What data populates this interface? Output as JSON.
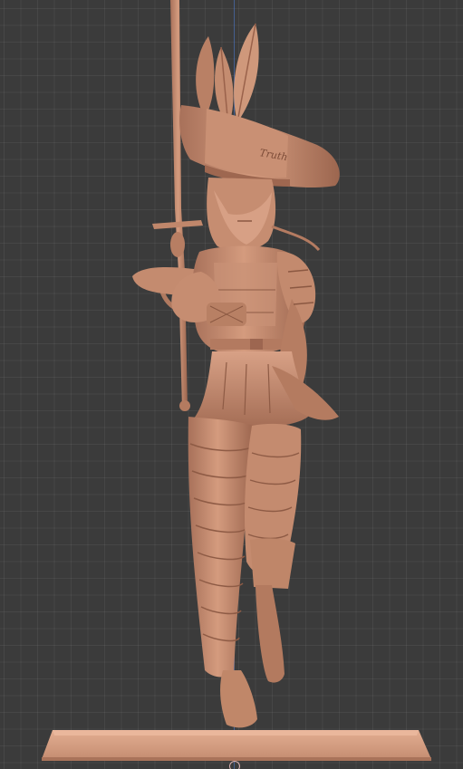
{
  "viewport": {
    "background": "#3b3b3b",
    "grid_color": "#4a4a4a",
    "axis_color": "#4a6fb5"
  },
  "model": {
    "subject": "armored-swordswoman-figurine",
    "material_color": "#c98f72",
    "shadow_color": "#8a5a45",
    "highlight_color": "#e2b196",
    "hat_band_text": "Truth"
  }
}
